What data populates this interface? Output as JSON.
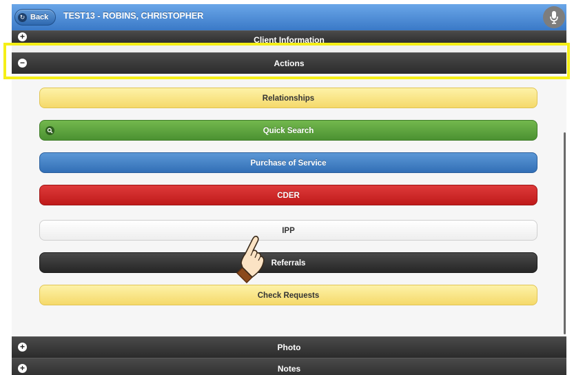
{
  "header": {
    "back_label": "Back",
    "patient_title": "TEST13 - ROBINS, CHRISTOPHER",
    "mic_icon": "microphone-icon"
  },
  "sections": {
    "client_information": "Client Information",
    "actions": "Actions",
    "photo": "Photo",
    "notes": "Notes"
  },
  "actions": {
    "relationships": "Relationships",
    "quick_search": "Quick Search",
    "purchase_of_service": "Purchase of Service",
    "cder": "CDER",
    "ipp": "IPP",
    "referrals": "Referrals",
    "check_requests": "Check Requests"
  },
  "colors": {
    "header_blue": "#3a79c7",
    "highlight_yellow": "#f5ef17",
    "button_yellow": "#f5d96a",
    "button_green": "#4b9132",
    "button_blue": "#326fb6",
    "button_red": "#bf1a1a",
    "button_dark": "#262626"
  }
}
